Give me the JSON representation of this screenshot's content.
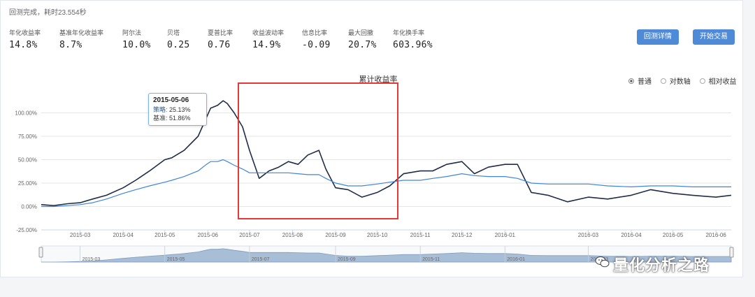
{
  "status": "回测完成，耗时23.554秒",
  "metrics": [
    {
      "label": "年化收益率",
      "value": "14.8%"
    },
    {
      "label": "基准年化收益率",
      "value": "8.7%"
    },
    {
      "label": "阿尔法",
      "value": "10.0%"
    },
    {
      "label": "贝塔",
      "value": "0.25"
    },
    {
      "label": "夏普比率",
      "value": "0.76"
    },
    {
      "label": "收益波动率",
      "value": "14.9%"
    },
    {
      "label": "信息比率",
      "value": "-0.09"
    },
    {
      "label": "最大回撤",
      "value": "20.7%"
    },
    {
      "label": "年化换手率",
      "value": "603.96%"
    }
  ],
  "buttons": {
    "detail": "回测详情",
    "trade": "开始交易"
  },
  "modes": [
    {
      "label": "普通",
      "selected": true
    },
    {
      "label": "对数轴",
      "selected": false
    },
    {
      "label": "相对收益",
      "selected": false
    }
  ],
  "tooltip": {
    "date": "2015-05-06",
    "s_label": "策略:",
    "s_value": "25.13%",
    "b_label": "基准:",
    "b_value": "51.86%"
  },
  "watermark": "量化分析之路",
  "colors": {
    "strategy": "#1f2d47",
    "benchmark": "#3f86d6",
    "button": "#4f8ad6",
    "highlight": "#e53935",
    "navigator": "#a8bdd6"
  },
  "chart_data": {
    "type": "line",
    "title": "累计收益率",
    "ylim": [
      -25,
      125
    ],
    "yticks": [
      "-25.00%",
      "0.00%",
      "25.00%",
      "50.00%",
      "75.00%",
      "100.00%"
    ],
    "ytick_values": [
      -25,
      0,
      25,
      50,
      75,
      100
    ],
    "xticks": [
      "2015-03",
      "2015-04",
      "2015-05",
      "2015-06",
      "2015-07",
      "2015-08",
      "2015-09",
      "2015-10",
      "2015-11",
      "2015-12",
      "2016-01",
      "2016-03",
      "2016-04",
      "2016-05",
      "2016-06"
    ],
    "xtick_dates": [
      "2015-03-01",
      "2015-04-01",
      "2015-05-01",
      "2015-06-01",
      "2015-07-01",
      "2015-08-01",
      "2015-09-01",
      "2015-10-01",
      "2015-11-01",
      "2015-12-01",
      "2016-01-01",
      "2016-03-01",
      "2016-04-01",
      "2016-05-01",
      "2016-06-01"
    ],
    "grid": true,
    "series": [
      {
        "name": "策略",
        "x": [
          "2015-02-01",
          "2015-02-10",
          "2015-02-20",
          "2015-03-01",
          "2015-03-10",
          "2015-03-20",
          "2015-04-01",
          "2015-04-10",
          "2015-04-20",
          "2015-05-01",
          "2015-05-06",
          "2015-05-15",
          "2015-05-25",
          "2015-05-31",
          "2015-06-03",
          "2015-06-08",
          "2015-06-12",
          "2015-06-15",
          "2015-06-20",
          "2015-06-26",
          "2015-07-01",
          "2015-07-08",
          "2015-07-15",
          "2015-07-22",
          "2015-07-29",
          "2015-08-05",
          "2015-08-12",
          "2015-08-20",
          "2015-08-25",
          "2015-09-01",
          "2015-09-10",
          "2015-09-20",
          "2015-10-01",
          "2015-10-10",
          "2015-10-20",
          "2015-11-01",
          "2015-11-10",
          "2015-11-20",
          "2015-12-01",
          "2015-12-10",
          "2015-12-20",
          "2016-01-01",
          "2016-01-10",
          "2016-01-20",
          "2016-02-01",
          "2016-02-15",
          "2016-03-01",
          "2016-03-15",
          "2016-04-01",
          "2016-04-15",
          "2016-05-01",
          "2016-05-15",
          "2016-06-01",
          "2016-06-12"
        ],
        "values": [
          2,
          1,
          3,
          4,
          8,
          12,
          20,
          28,
          38,
          50,
          52,
          60,
          75,
          95,
          105,
          108,
          113,
          110,
          100,
          85,
          60,
          30,
          38,
          42,
          48,
          45,
          55,
          60,
          40,
          20,
          18,
          10,
          15,
          22,
          35,
          38,
          38,
          45,
          48,
          35,
          42,
          45,
          45,
          15,
          12,
          5,
          10,
          8,
          12,
          18,
          14,
          12,
          10,
          12
        ]
      },
      {
        "name": "基准",
        "x": [
          "2015-02-01",
          "2015-02-10",
          "2015-02-20",
          "2015-03-01",
          "2015-03-10",
          "2015-03-20",
          "2015-04-01",
          "2015-04-10",
          "2015-04-20",
          "2015-05-01",
          "2015-05-06",
          "2015-05-15",
          "2015-05-25",
          "2015-05-31",
          "2015-06-03",
          "2015-06-08",
          "2015-06-12",
          "2015-06-15",
          "2015-06-20",
          "2015-06-26",
          "2015-07-01",
          "2015-07-08",
          "2015-07-15",
          "2015-07-22",
          "2015-07-29",
          "2015-08-05",
          "2015-08-12",
          "2015-08-20",
          "2015-08-25",
          "2015-09-01",
          "2015-09-10",
          "2015-09-20",
          "2015-10-01",
          "2015-10-10",
          "2015-10-20",
          "2015-11-01",
          "2015-11-10",
          "2015-11-20",
          "2015-12-01",
          "2015-12-10",
          "2015-12-20",
          "2016-01-01",
          "2016-01-10",
          "2016-01-20",
          "2016-02-01",
          "2016-02-15",
          "2016-03-01",
          "2016-03-15",
          "2016-04-01",
          "2016-04-15",
          "2016-05-01",
          "2016-05-15",
          "2016-06-01",
          "2016-06-12"
        ],
        "values": [
          0,
          0,
          1,
          2,
          4,
          8,
          14,
          18,
          22,
          26,
          28,
          32,
          38,
          45,
          48,
          48,
          50,
          48,
          44,
          40,
          36,
          36,
          36,
          36,
          36,
          35,
          34,
          34,
          30,
          25,
          22,
          22,
          24,
          26,
          28,
          28,
          30,
          32,
          35,
          33,
          32,
          32,
          30,
          25,
          24,
          24,
          24,
          22,
          21,
          22,
          22,
          21,
          21,
          21
        ]
      }
    ],
    "navigator_ticks": [
      "2015-03",
      "2015-05",
      "2015-07",
      "2015-09",
      "2015-11",
      "2016-01",
      "2016-03"
    ],
    "navigator_dates": [
      "2015-03-01",
      "2015-05-01",
      "2015-07-01",
      "2015-09-01",
      "2015-11-01",
      "2016-01-01",
      "2016-03-01"
    ]
  }
}
